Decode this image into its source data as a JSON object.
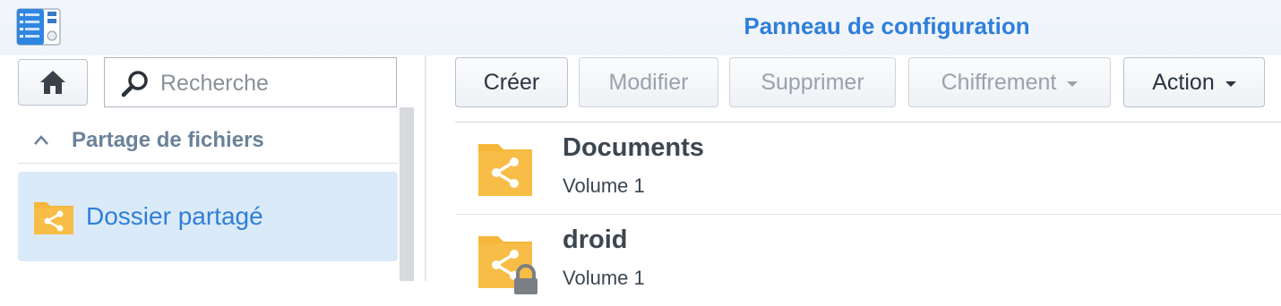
{
  "window": {
    "title": "Panneau de configuration",
    "app_icon": "control-panel-icon"
  },
  "sidebar": {
    "home_icon": "home-icon",
    "search": {
      "placeholder": "Recherche",
      "value": ""
    },
    "section": {
      "label": "Partage de fichiers",
      "expanded": true
    },
    "items": [
      {
        "label": "Dossier partagé",
        "icon": "shared-folder-icon",
        "selected": true
      }
    ]
  },
  "toolbar": {
    "create_label": "Créer",
    "modify_label": "Modifier",
    "delete_label": "Supprimer",
    "encryption_label": "Chiffrement",
    "action_label": "Action"
  },
  "folders": [
    {
      "name": "Documents",
      "volume": "Volume 1",
      "locked": false,
      "icon": "shared-folder-icon"
    },
    {
      "name": "droid",
      "volume": "Volume 1",
      "locked": true,
      "icon": "locked-shared-folder-icon"
    }
  ],
  "colors": {
    "accent": "#2f7fdb",
    "folder": "#f5b63b",
    "selected_bg": "#dbeaf8",
    "section_text": "#6b8299"
  }
}
